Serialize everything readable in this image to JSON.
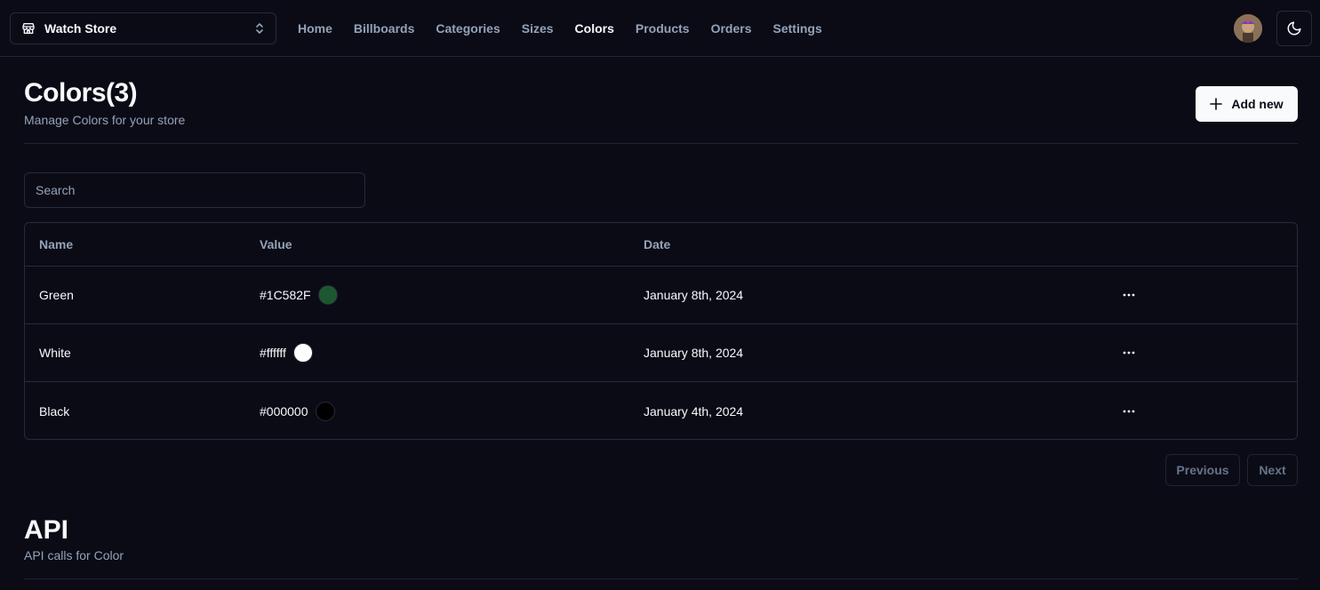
{
  "store": {
    "name": "Watch Store"
  },
  "nav": [
    {
      "label": "Home",
      "active": false
    },
    {
      "label": "Billboards",
      "active": false
    },
    {
      "label": "Categories",
      "active": false
    },
    {
      "label": "Sizes",
      "active": false
    },
    {
      "label": "Colors",
      "active": true
    },
    {
      "label": "Products",
      "active": false
    },
    {
      "label": "Orders",
      "active": false
    },
    {
      "label": "Settings",
      "active": false
    }
  ],
  "header": {
    "title": "Colors(3)",
    "subtitle": "Manage Colors for your store",
    "add_label": "Add new"
  },
  "search": {
    "placeholder": "Search"
  },
  "table": {
    "headers": {
      "name": "Name",
      "value": "Value",
      "date": "Date"
    },
    "rows": [
      {
        "name": "Green",
        "value": "#1C582F",
        "swatch": "#1C582F",
        "date": "January 8th, 2024"
      },
      {
        "name": "White",
        "value": "#ffffff",
        "swatch": "#ffffff",
        "date": "January 8th, 2024"
      },
      {
        "name": "Black",
        "value": "#000000",
        "swatch": "#000000",
        "date": "January 4th, 2024"
      }
    ]
  },
  "pagination": {
    "previous": "Previous",
    "next": "Next"
  },
  "api": {
    "title": "API",
    "subtitle": "API calls for Color"
  },
  "colors": {
    "background": "#0b0b16",
    "foreground": "#f8fafc",
    "muted": "#94a3b8",
    "border": "#262b3a"
  }
}
